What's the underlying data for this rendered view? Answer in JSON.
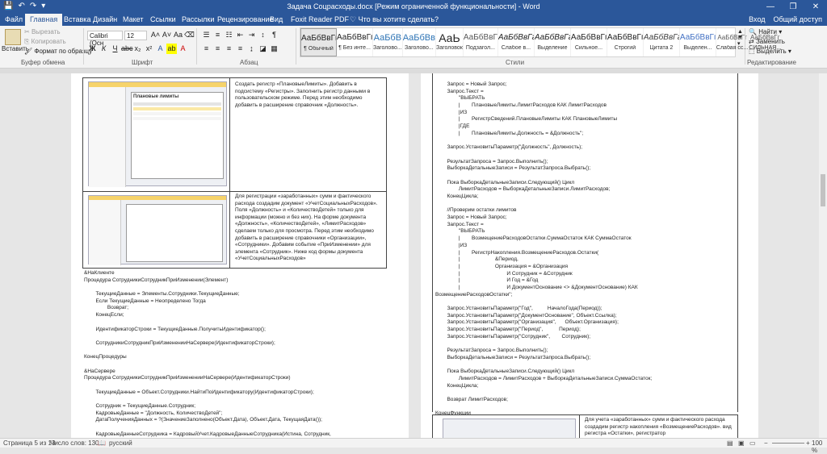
{
  "window": {
    "title": "Задача Соцрасходы.docx [Режим ограниченной функциональности] - Word",
    "controls": [
      "—",
      "❐",
      "✕"
    ]
  },
  "qat": {
    "save": "💾",
    "undo": "↶",
    "redo": "↷",
    "more": "▾"
  },
  "tabs": [
    "Файл",
    "Главная",
    "Вставка",
    "Дизайн",
    "Макет",
    "Ссылки",
    "Рассылки",
    "Рецензирование",
    "Вид",
    "Foxit Reader PDF"
  ],
  "active_tab": "Главная",
  "tell_me": "♡ Что вы хотите сделать?",
  "signin": "Вход",
  "share": "Общий доступ",
  "ribbon": {
    "clipboard": {
      "paste": "Вставить",
      "cut": "Вырезать",
      "copy": "Копировать",
      "format": "Формат по образцу",
      "label": "Буфер обмена"
    },
    "font": {
      "name": "Calibri (Осн",
      "size": "12",
      "label": "Шрифт"
    },
    "paragraph": {
      "label": "Абзац"
    },
    "styles": {
      "label": "Стили",
      "items": [
        {
          "preview": "АаБбВвГг,",
          "name": "¶ Обычный"
        },
        {
          "preview": "АаБбВвГг,",
          "name": "¶ Без инте..."
        },
        {
          "preview": "АаБбВ",
          "name": "Заголово..."
        },
        {
          "preview": "АаБбВв",
          "name": "Заголово..."
        },
        {
          "preview": "АаЬ",
          "name": "Заголовок"
        },
        {
          "preview": "АаБбВвГ",
          "name": "Подзагол..."
        },
        {
          "preview": "АаБбВвГг",
          "name": "Слабое в..."
        },
        {
          "preview": "АаБбВвГг",
          "name": "Выделение"
        },
        {
          "preview": "АаБбВвГг",
          "name": "Сильное..."
        },
        {
          "preview": "АаБбВвГг",
          "name": "Строгий"
        },
        {
          "preview": "АаБбВвГг",
          "name": "Цитата 2"
        },
        {
          "preview": "АаБбВвГг",
          "name": "Выделен..."
        },
        {
          "preview": "АаБбВвГг",
          "name": "Слабая сс..."
        },
        {
          "preview": "АаБбВвГг",
          "name": "СИЛЬНАЯ..."
        }
      ]
    },
    "editing": {
      "find": "Найти",
      "replace": "Заменить",
      "select": "Выделить",
      "label": "Редактирование"
    }
  },
  "left_page": {
    "cell1": "Создать регистр «ПлановыеЛимиты». Добавить в подсистему «Регистры». Заполнить регистр данными в пользовательском режиме. Перед этим необходимо добавить в расширение справочник «Должность».",
    "cell2": "Для регистрации «заработанных» сумм и фактического расхода создадим документ «УчетСоциальныхРасходов». Поля «Должность» и «КоличествоДетей» только для информации (можно и без них). На форме документа «Должность», «КоличествоДетей», «ЛимитРасходов» сделаем только для просмотра. Перед этим необходимо добавить в расширение справочники «Организации», «Сотрудники». Добавим событие «ПриИзменении» для элемента «Сотрудник». Ниже код формы документа «УчетСоциальныхРасходов»",
    "screen_title": "Плановые лимиты",
    "code": [
      "&НаКлиенте",
      "Процедура СотрудникиСотрудникПриИзменении(Элемент)",
      "",
      "        ТекущиеДанные = Элементы.Сотрудники.ТекущиеДанные;",
      "        Если ТекущиеДанные = Неопределено Тогда",
      "                Возврат;",
      "        КонецЕсли;",
      "",
      "        ИдентификаторСтроки = ТекущиеДанные.ПолучитьИдентификатор();",
      "",
      "        СотрудникиСотрудникПриИзмененииНаСервере(ИдентификаторСтроки);",
      "",
      "КонецПроцедуры",
      "",
      "&НаСервере",
      "Процедура СотрудникиСотрудникПриИзмененииНаСервере(ИдентификаторСтроки)",
      "",
      "        ТекущиеДанные = Объект.Сотрудники.НайтиПоИдентификатору(ИдентификаторСтроки);",
      "",
      "        Сотрудник = ТекущиеДанные.Сотрудник;",
      "        КадровыеДанные = \"Должность, КоличествоДетей\";",
      "        ДатаПолученияДанных = ?(ЗначениеЗаполнено(Объект.Дата), Объект.Дата, ТекущаяДата());",
      "",
      "        КадровыеДанныеСотрудника = КадровыйУчет.КадровыеДанныеСотрудника(Истина, Сотрудник,"
    ]
  },
  "right_page": {
    "code": [
      "        Запрос = Новый Запрос;",
      "        Запрос.Текст =",
      "                \"ВЫБРАТЬ",
      "                |        ПлановыеЛимиты.ЛимитРасходов КАК ЛимитРасходов",
      "                |ИЗ",
      "                |        РегистрСведений.ПлановыеЛимиты КАК ПлановыеЛимиты",
      "                |ГДЕ",
      "                |        ПлановыеЛимиты.Должность = &Должность\";",
      "",
      "        Запрос.УстановитьПараметр(\"Должность\", Должность);",
      "",
      "        РезультатЗапроса = Запрос.Выполнить();",
      "        ВыборкаДетальныеЗаписи = РезультатЗапроса.Выбрать();",
      "",
      "        Пока ВыборкаДетальныеЗаписи.Следующий() Цикл",
      "                ЛимитРасходов = ВыборкаДетальныеЗаписи.ЛимитРасходов;",
      "        КонецЦикла;",
      "",
      "        //Проверим остатки лимитов",
      "        Запрос = Новый Запрос;",
      "        Запрос.Текст =",
      "                \"ВЫБРАТЬ",
      "                |        ВозмещениеРасходовОстатки.СуммаОстаток КАК СуммаОстаток",
      "                |ИЗ",
      "                |        РегистрНакопления.ВозмещениеРасходов.Остатки(",
      "                |                        &Период,",
      "                |                        Организация = &Организация",
      "                |                                И Сотрудник = &Сотрудник",
      "                |                                И Год = &Год",
      "                |                                И ДокументОснование <> &ДокументОснование) КАК",
      "ВозмещениеРасходовОстатки\";",
      "",
      "        Запрос.УстановитьПараметр(\"Год\",          НачалоГода(Период));",
      "        Запрос.УстановитьПараметр(\"ДокументОснование\", Объект.Ссылка);",
      "        Запрос.УстановитьПараметр(\"Организация\",      Объект.Организация);",
      "        Запрос.УстановитьПараметр(\"Период\",           Период);",
      "        Запрос.УстановитьПараметр(\"Сотрудник\",        Сотрудник);",
      "",
      "        РезультатЗапроса = Запрос.Выполнить();",
      "        ВыборкаДетальныеЗаписи = РезультатЗапроса.Выбрать();",
      "",
      "        Пока ВыборкаДетальныеЗаписи.Следующий() Цикл",
      "                ЛимитРасходов = ЛимитРасходов + ВыборкаДетальныеЗаписи.СуммаОстаток;",
      "        КонецЦикла;",
      "",
      "        Возврат ЛимитРасходов;",
      "",
      "КонецФункции"
    ],
    "cell": "Для учета «заработанных» сумм и фактического расхода создадим регистр накопления «ВозмещениеРасходов». вид регистра «Остатки», регистратор"
  },
  "status": {
    "page": "Страница 5 из 13",
    "words": "Число слов: 1304",
    "lang": "русский",
    "zoom": "100 %"
  }
}
